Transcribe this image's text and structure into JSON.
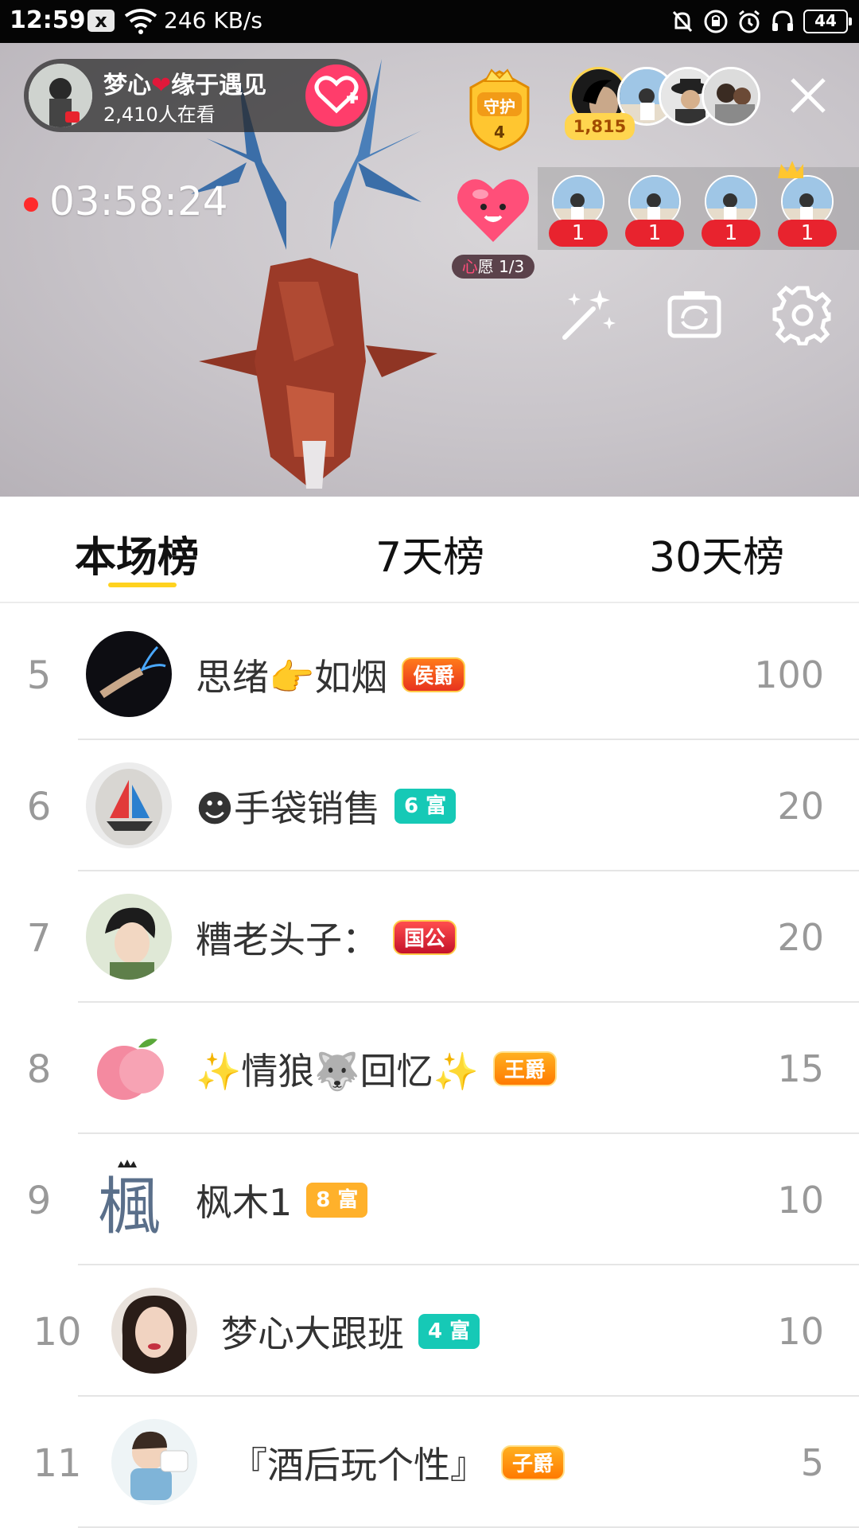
{
  "status_bar": {
    "time": "12:59",
    "notification_icon": "x",
    "speed": "246 KB/s",
    "battery": "44"
  },
  "live": {
    "host_name_left": "梦心",
    "host_name_right": "缘于遇见",
    "viewers": "2,410人在看",
    "guard_label": "守护",
    "guard_count": "4",
    "top_coin": "1,815",
    "timer": "03:58:24",
    "wish_prefix": "心",
    "wish_label": "愿 1/3",
    "pk_counts": [
      "1",
      "1",
      "1",
      "1"
    ]
  },
  "tabs": [
    {
      "label": "本场榜",
      "active": true
    },
    {
      "label": "7天榜",
      "active": false
    },
    {
      "label": "30天榜",
      "active": false
    }
  ],
  "ranking": [
    {
      "rank": "5",
      "name": "思绪👉如烟",
      "badge": "侯爵",
      "badge_style": "noble",
      "score": "100"
    },
    {
      "rank": "6",
      "name": "☻手袋销售",
      "badge": "6 富",
      "badge_style": "teal",
      "score": "20"
    },
    {
      "rank": "7",
      "name": "糟老头子：",
      "badge": "国公",
      "badge_style": "noble-red",
      "score": "20"
    },
    {
      "rank": "8",
      "name": "✨情狼🐺回忆✨",
      "badge": "王爵",
      "badge_style": "noble-orange",
      "score": "15"
    },
    {
      "rank": "9",
      "name": "枫木1",
      "badge": "8 富",
      "badge_style": "gold",
      "score": "10"
    },
    {
      "rank": "10",
      "name": "梦心大跟班",
      "badge": "4 富",
      "badge_style": "teal",
      "score": "10"
    },
    {
      "rank": "11",
      "name": "『酒后玩个性』",
      "badge": "子爵",
      "badge_style": "noble-orange",
      "score": "5"
    }
  ],
  "colors": {
    "accent_yellow": "#ffd21f",
    "follow_pink": "#ff3d6b",
    "rank_gray": "#999999",
    "rich_teal": "#16c9b6",
    "rich_gold": "#ffb12b"
  }
}
